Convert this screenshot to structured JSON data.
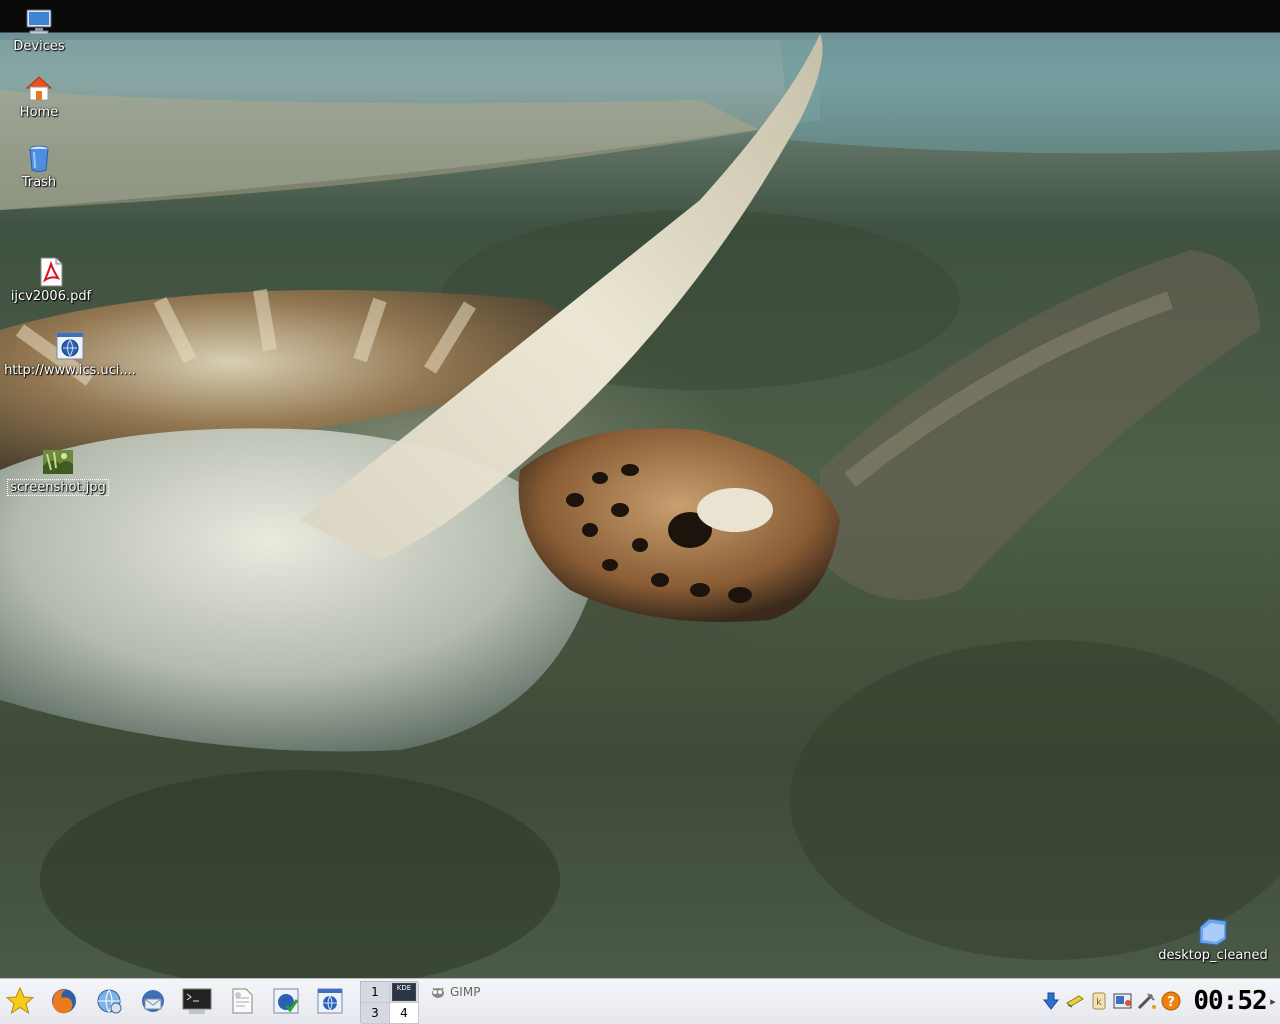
{
  "desktop": {
    "icons": [
      {
        "label": "Devices",
        "icon": "computer-icon"
      },
      {
        "label": "Home",
        "icon": "home-icon"
      },
      {
        "label": "Trash",
        "icon": "trash-icon"
      },
      {
        "label": "ijcv2006.pdf",
        "icon": "pdf-file-icon"
      },
      {
        "label": "http://www.ics.uci....",
        "icon": "web-link-icon"
      },
      {
        "label": "screenshot.jpg",
        "icon": "image-file-icon",
        "selected": true
      },
      {
        "label": "desktop_cleaned",
        "icon": "folder-icon"
      }
    ]
  },
  "panel": {
    "launchers": [
      {
        "name": "k-menu",
        "icon": "star-icon"
      },
      {
        "name": "firefox",
        "icon": "firefox-icon"
      },
      {
        "name": "konqueror",
        "icon": "globe-gear-icon"
      },
      {
        "name": "thunderbird",
        "icon": "mail-bird-icon"
      },
      {
        "name": "terminal",
        "icon": "terminal-icon"
      },
      {
        "name": "file-manager",
        "icon": "document-icon"
      },
      {
        "name": "web-shortcut-1",
        "icon": "web-check-icon"
      },
      {
        "name": "web-shortcut-2",
        "icon": "web-link-icon"
      }
    ],
    "pager": {
      "desktops": [
        "1",
        "KDE",
        "3",
        "4"
      ],
      "active": "4"
    },
    "taskbar": [
      {
        "label": "GIMP",
        "icon": "gimp-icon"
      }
    ],
    "tray": [
      {
        "icon": "download-arrow-icon"
      },
      {
        "icon": "clipboard-icon"
      },
      {
        "icon": "kwallet-icon"
      },
      {
        "icon": "kpilot-icon"
      },
      {
        "icon": "network-icon"
      },
      {
        "icon": "help-icon"
      }
    ],
    "clock": "00:52",
    "more_arrow": "▸"
  },
  "colors": {
    "panel_bg": "#eceef2",
    "clock_text": "#000000",
    "help_orange": "#f08010"
  }
}
